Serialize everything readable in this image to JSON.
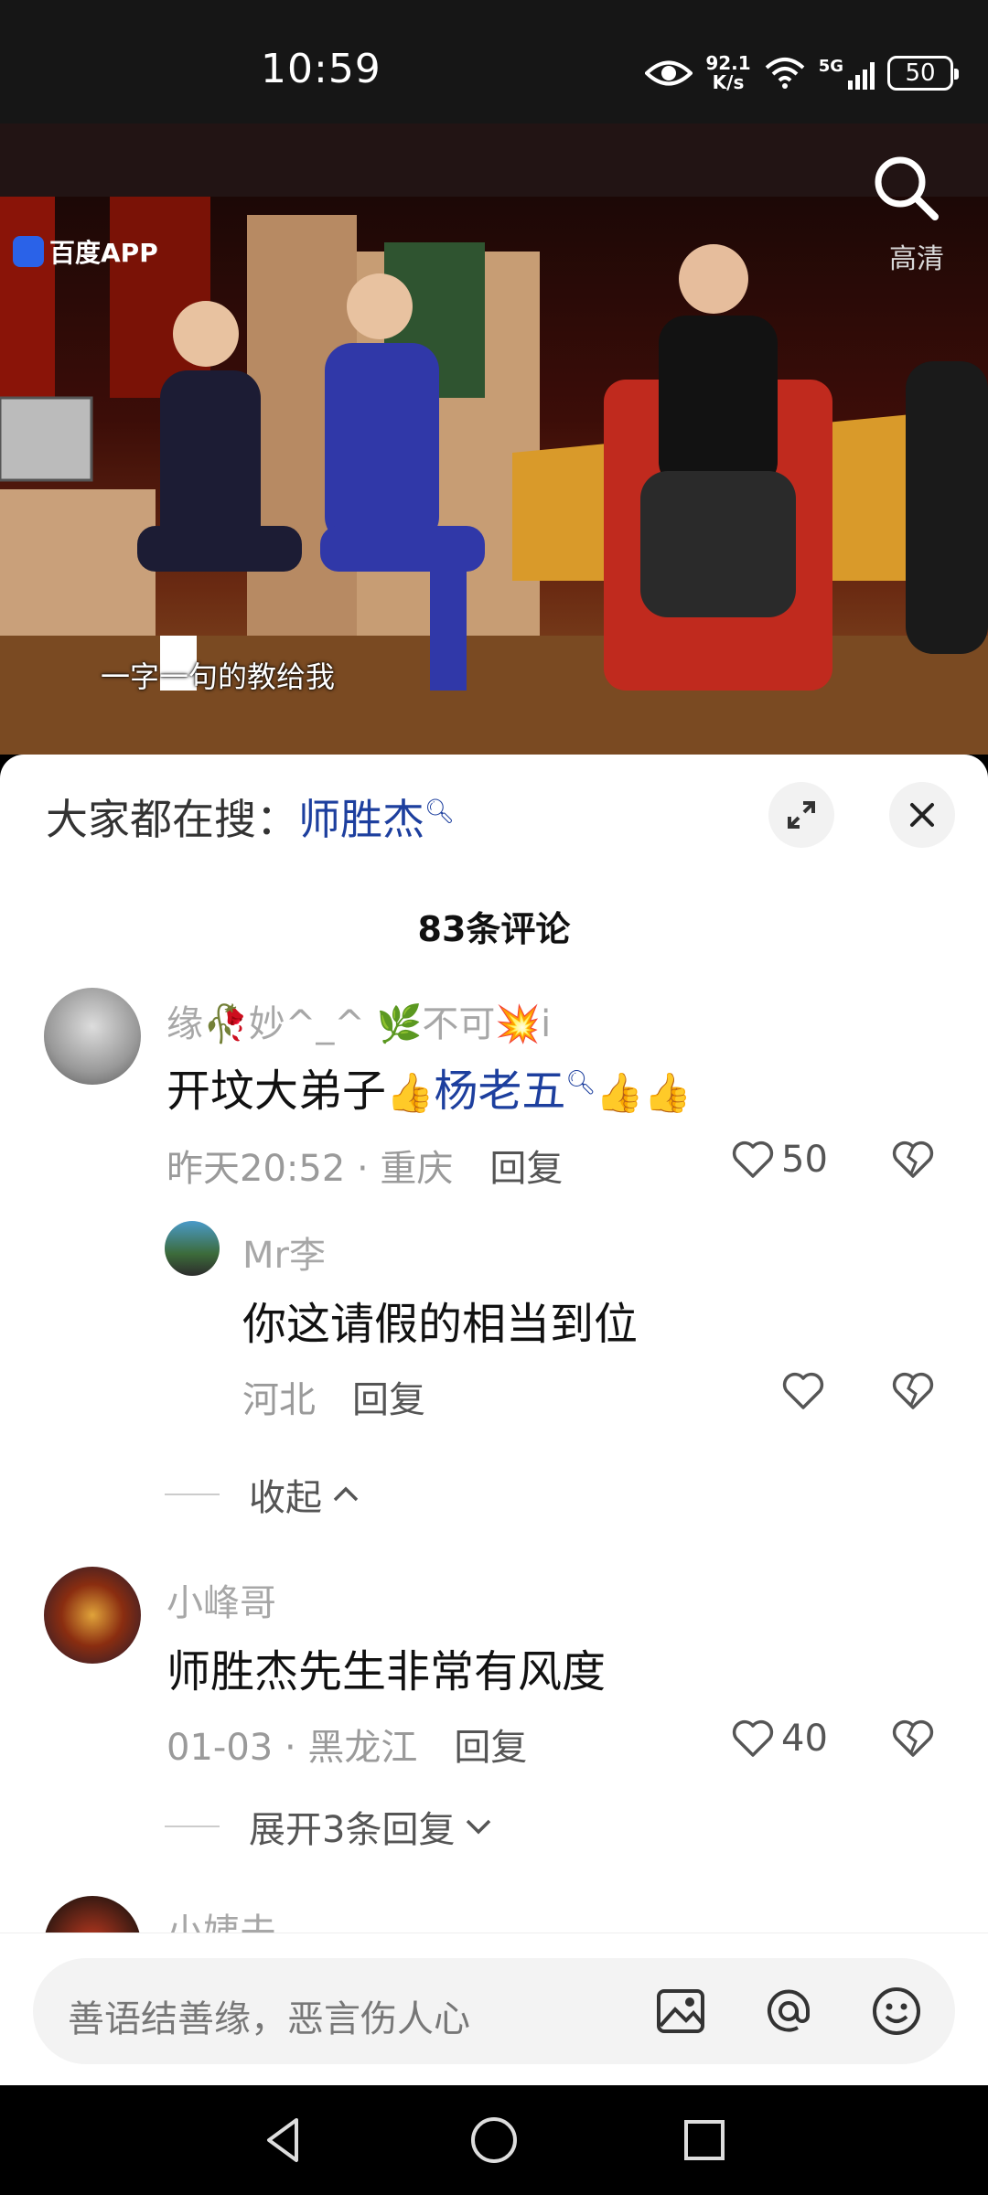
{
  "status_bar": {
    "time": "10:59",
    "net_speed_value": "92.1",
    "net_speed_unit": "K/s",
    "network": "5G",
    "battery": "50"
  },
  "video": {
    "app_logo": "百度APP",
    "hd_label": "高清",
    "subtitle": "一字一句的教给我"
  },
  "hot_search": {
    "prefix": "大家都在搜：",
    "keyword": "师胜杰"
  },
  "comments_header": {
    "count_label": "83条评论"
  },
  "comments": [
    {
      "user": "缘🥀妙^_^ 🌿不可💥i",
      "text_before_link": "开坟大弟子",
      "link": "杨老五",
      "meta": "昨天20:52 · 重庆",
      "reply_label": "回复",
      "likes": "50",
      "replies": [
        {
          "user": "Mr李",
          "text": "你这请假的相当到位",
          "meta": "河北",
          "reply_label": "回复"
        }
      ],
      "fold_label": "收起"
    },
    {
      "user": "小峰哥",
      "text": "师胜杰先生非常有风度",
      "meta": "01-03 · 黑龙江",
      "reply_label": "回复",
      "likes": "40",
      "fold_label": "展开3条回复"
    },
    {
      "user": "小姨夫"
    }
  ],
  "input": {
    "placeholder": "善语结善缘，恶言伤人心"
  },
  "colors": {
    "link": "#1d3f9e",
    "status_bg": "#161616"
  }
}
